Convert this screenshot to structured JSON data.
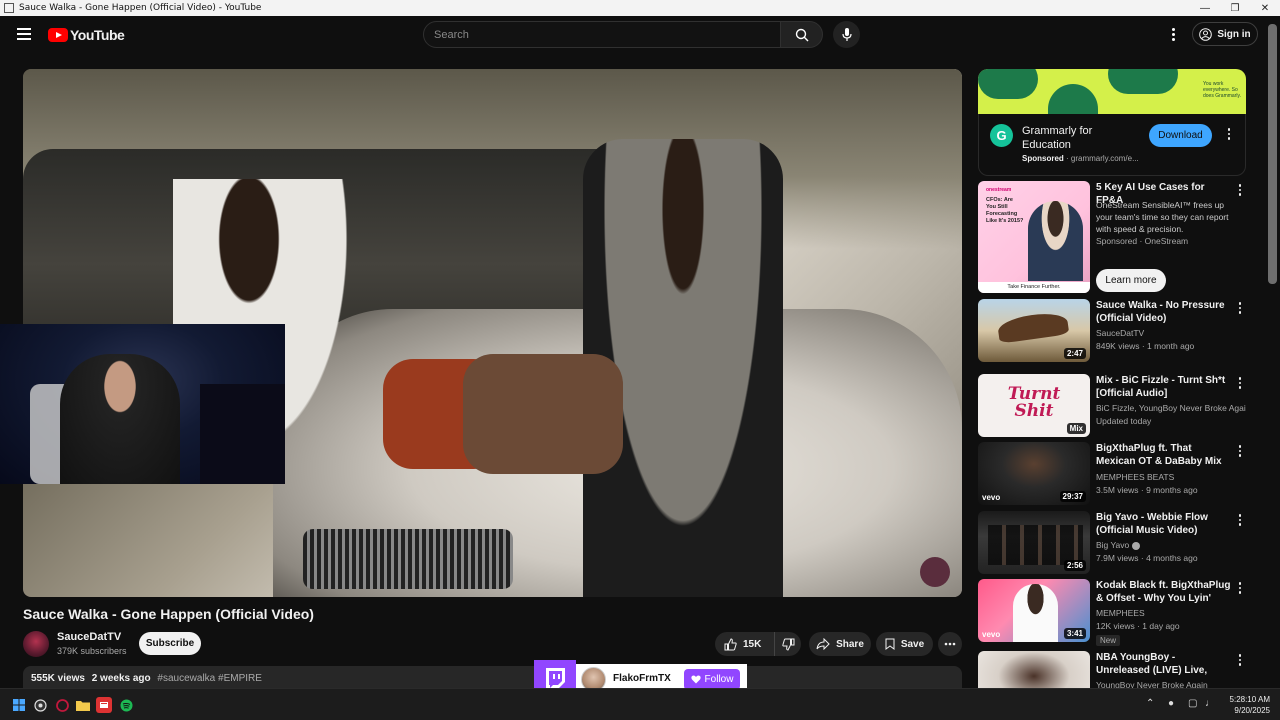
{
  "window": {
    "title": "Sauce Walka - Gone Happen (Official Video) - YouTube"
  },
  "header": {
    "logo_text": "YouTube",
    "search_placeholder": "Search",
    "sign_in_label": "Sign in"
  },
  "video": {
    "title": "Sauce Walka - Gone Happen (Official Video)",
    "channel": "SauceDatTV",
    "subscribers": "379K subscribers",
    "subscribe_label": "Subscribe",
    "likes": "15K",
    "share_label": "Share",
    "save_label": "Save",
    "views": "555K views",
    "date": "2 weeks ago",
    "hashtags": "#saucewalka #EMPIRE"
  },
  "ad": {
    "name": "Grammarly for Education",
    "sponsored": "Sponsored",
    "domain": "grammarly.com/e...",
    "cta": "Download",
    "banner_text": "You work everywhere. So does Grammarly.",
    "logo_letter": "G"
  },
  "recommendations": [
    {
      "title": "5 Key AI Use Cases for FP&A",
      "channel": "OneStream SensibleAI™ frees up your team's time so they can report with speed & precision.",
      "meta": "Sponsored · OneStream",
      "cta": "Learn more",
      "thumb_text": "CFOs: Are You Still Forecasting Like It's 2015?",
      "thumb_caption": "Take Finance Further.",
      "thumb_brand": "onestream"
    },
    {
      "title": "Sauce Walka - No Pressure (Official Video)",
      "channel": "SauceDatTV",
      "meta": "849K views · 1 month ago",
      "duration": "2:47"
    },
    {
      "title": "Mix - BiC Fizzle - Turnt Sh*t [Official Audio]",
      "channel": "BiC Fizzle, YoungBoy Never Broke Again, ...",
      "meta": "Updated today",
      "duration": "Mix",
      "thumb_text": "Turnt Shit"
    },
    {
      "title": "BigXthaPlug ft. That Mexican OT & DaBaby Mix [Unreleased ...",
      "channel": "MEMPHEES BEATS",
      "meta": "3.5M views · 9 months ago",
      "duration": "29:37",
      "vevo": "vevo"
    },
    {
      "title": "Big Yavo - Webbie Flow (Official Music Video)",
      "channel": "Big Yavo",
      "meta": "7.9M views · 4 months ago",
      "duration": "2:56"
    },
    {
      "title": "Kodak Black ft. BigXthaPlug & Offset - Why You Lyin' (Music ...",
      "channel": "MEMPHEES",
      "meta": "12K views · 1 day ago",
      "duration": "3:41",
      "badge": "New",
      "vevo": "vevo"
    },
    {
      "title": "NBA YoungBoy - Unreleased (LIVE) Live, Speed Racing, War",
      "channel": "YoungBoy Never Broke Again",
      "meta": ""
    }
  ],
  "twitch": {
    "username": "FlakoFrmTX",
    "follow_label": "Follow"
  },
  "taskbar": {
    "time": "5:28:10 AM",
    "date": "9/20/2025"
  },
  "colors": {
    "accent_red": "#ff0000",
    "link_blue": "#3ea6ff",
    "twitch_purple": "#9146ff",
    "grammarly_green": "#15c39a"
  }
}
